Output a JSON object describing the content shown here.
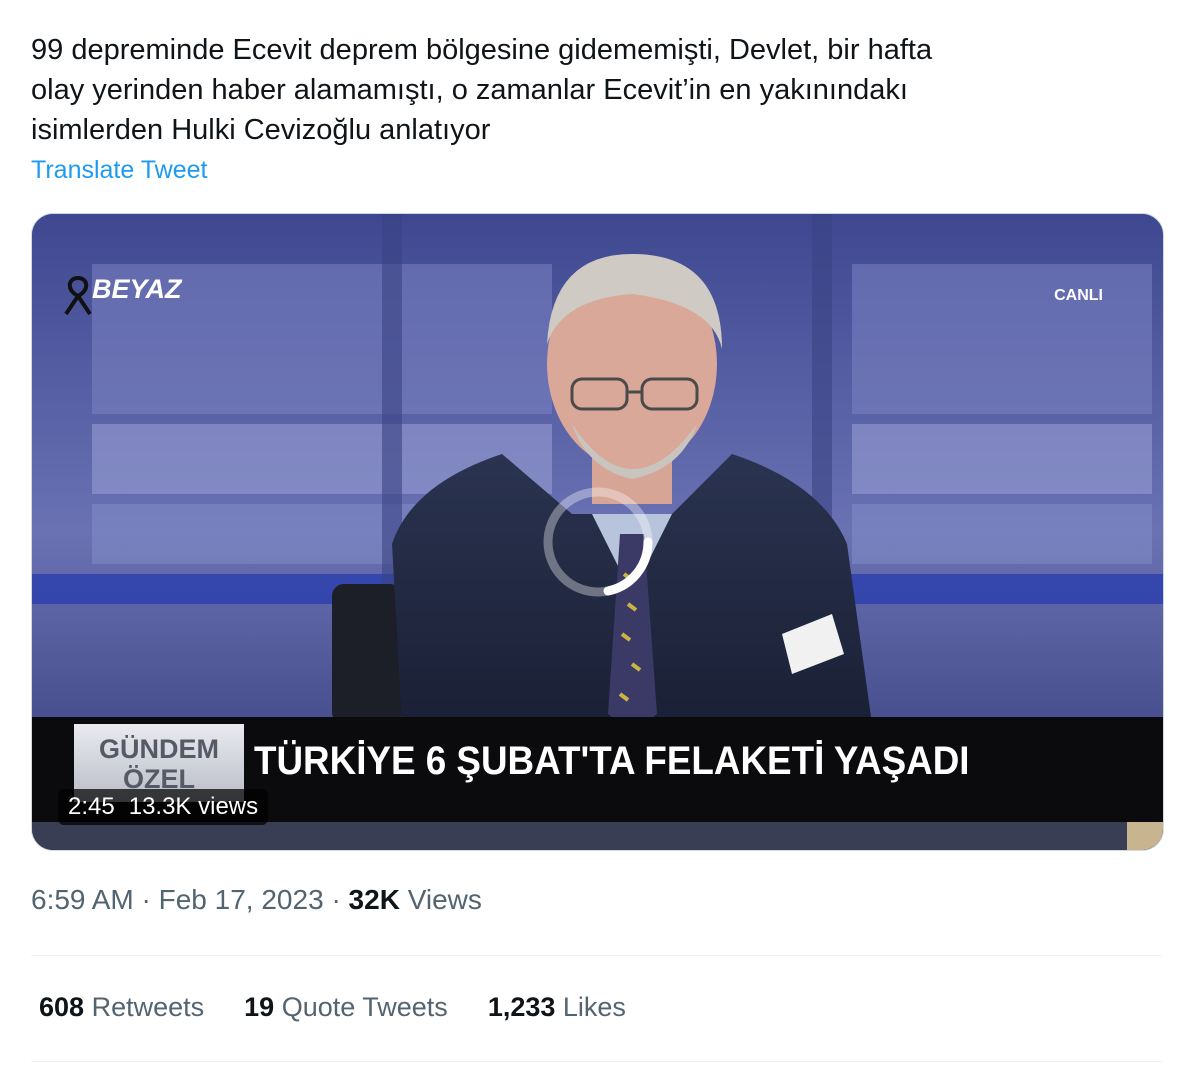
{
  "tweet": {
    "text": "99 depreminde Ecevit deprem bölgesine gidememişti, Devlet, bir hafta\nolay yerinden haber alamamıştı, o zamanlar Ecevit’in en yakınındakı\nisimlerden Hulki Cevizoğlu anlatıyor",
    "translate_label": "Translate Tweet"
  },
  "video": {
    "channel_logo": "BEYAZ",
    "live_label": "CANLI",
    "program_tag": "GÜNDEM\nÖZEL",
    "headline": "TÜRKİYE 6 ŞUBAT'TA FELAKETİ YAŞADI",
    "duration": "2:45",
    "views": "13.3K views"
  },
  "meta": {
    "time": "6:59 AM",
    "separator": "·",
    "date": "Feb 17, 2023",
    "views_count": "32K",
    "views_label": "Views"
  },
  "stats": {
    "retweets_count": "608",
    "retweets_label": "Retweets",
    "quotes_count": "19",
    "quotes_label": "Quote Tweets",
    "likes_count": "1,233",
    "likes_label": "Likes"
  },
  "colors": {
    "link": "#1d9bf0",
    "secondary_text": "#536471",
    "primary_text": "#0f1419",
    "studio_blue": "#4f5a9e"
  }
}
